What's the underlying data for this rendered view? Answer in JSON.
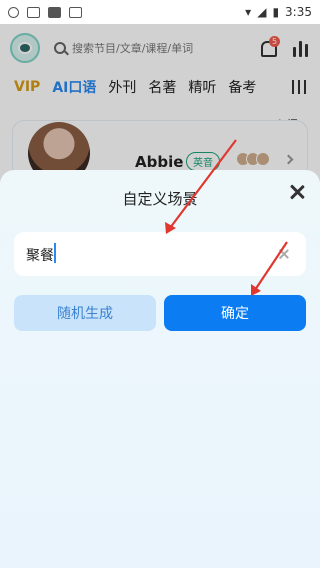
{
  "status_bar": {
    "time": "3:35"
  },
  "header": {
    "search_placeholder": "搜索节目/文章/课程/单词",
    "notification_count": "5"
  },
  "tabs": [
    "VIP",
    "AI口语",
    "外刊",
    "名著",
    "精听",
    "备考"
  ],
  "entry_label": "入门",
  "card": {
    "name": "Abbie",
    "tag": "英音"
  },
  "dialog": {
    "title": "自定义场景",
    "input_value": "聚餐",
    "random_button": "随机生成",
    "confirm_button": "确定"
  },
  "colors": {
    "primary": "#0b7cf2",
    "secondary_btn": "#c9e3fb",
    "annotation_arrow": "#e0372f"
  }
}
